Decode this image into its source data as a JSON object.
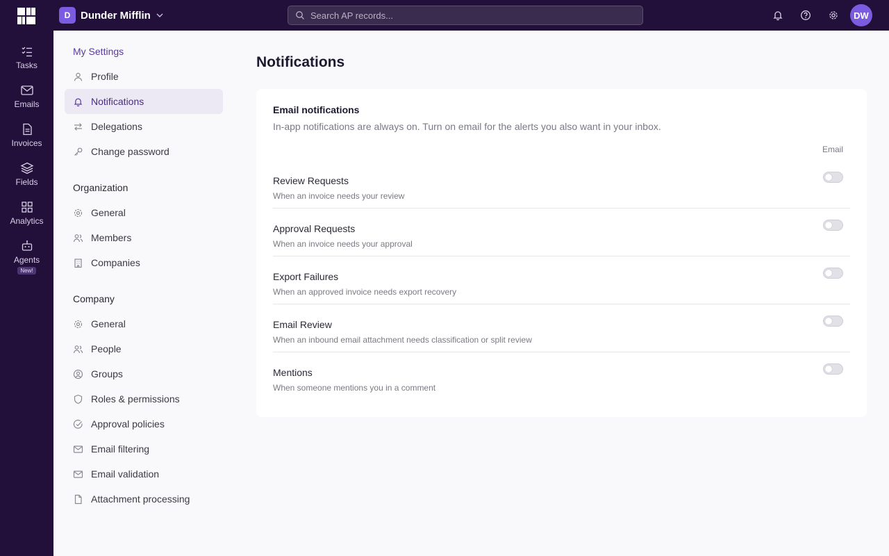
{
  "header": {
    "org_initial": "D",
    "org_name": "Dunder Mifflin",
    "search_placeholder": "Search AP records...",
    "user_initials": "DW",
    "icons": [
      "logo-icon",
      "chevron-down-icon",
      "search-icon",
      "bell-icon",
      "help-icon",
      "gear-icon"
    ]
  },
  "rail": {
    "items": [
      {
        "label": "Tasks",
        "icon": "tasks-icon"
      },
      {
        "label": "Emails",
        "icon": "mail-icon"
      },
      {
        "label": "Invoices",
        "icon": "document-icon"
      },
      {
        "label": "Fields",
        "icon": "layers-icon"
      },
      {
        "label": "Analytics",
        "icon": "grid-icon"
      },
      {
        "label": "Agents",
        "icon": "robot-icon",
        "badge": "New!"
      }
    ]
  },
  "settings_nav": {
    "my_settings": {
      "title": "My Settings",
      "items": [
        {
          "label": "Profile",
          "icon": "user-icon"
        },
        {
          "label": "Notifications",
          "icon": "bell-icon",
          "active": true
        },
        {
          "label": "Delegations",
          "icon": "swap-icon"
        },
        {
          "label": "Change password",
          "icon": "key-icon"
        }
      ]
    },
    "organization": {
      "title": "Organization",
      "items": [
        {
          "label": "General",
          "icon": "gear-icon"
        },
        {
          "label": "Members",
          "icon": "users-icon"
        },
        {
          "label": "Companies",
          "icon": "building-icon"
        }
      ]
    },
    "company": {
      "title": "Company",
      "items": [
        {
          "label": "General",
          "icon": "gear-icon"
        },
        {
          "label": "People",
          "icon": "users-icon"
        },
        {
          "label": "Groups",
          "icon": "user-circle-icon"
        },
        {
          "label": "Roles & permissions",
          "icon": "shield-icon"
        },
        {
          "label": "Approval policies",
          "icon": "check-circle-icon"
        },
        {
          "label": "Email filtering",
          "icon": "mail-icon"
        },
        {
          "label": "Email validation",
          "icon": "mail-icon"
        },
        {
          "label": "Attachment processing",
          "icon": "file-icon"
        }
      ]
    }
  },
  "main": {
    "title": "Notifications",
    "card": {
      "title": "Email notifications",
      "subtitle": "In-app notifications are always on. Turn on email for the alerts you also want in your inbox.",
      "column_header": "Email",
      "rows": [
        {
          "title": "Review Requests",
          "description": "When an invoice needs your review",
          "email_enabled": false
        },
        {
          "title": "Approval Requests",
          "description": "When an invoice needs your approval",
          "email_enabled": false
        },
        {
          "title": "Export Failures",
          "description": "When an approved invoice needs export recovery",
          "email_enabled": false
        },
        {
          "title": "Email Review",
          "description": "When an inbound email attachment needs classification or split review",
          "email_enabled": false
        },
        {
          "title": "Mentions",
          "description": "When someone mentions you in a comment",
          "email_enabled": false
        }
      ]
    }
  },
  "colors": {
    "sidebar_bg": "#23103a",
    "accent": "#7b5ce0",
    "active_nav_bg": "#ece8f4",
    "page_bg": "#f9f9fb"
  }
}
